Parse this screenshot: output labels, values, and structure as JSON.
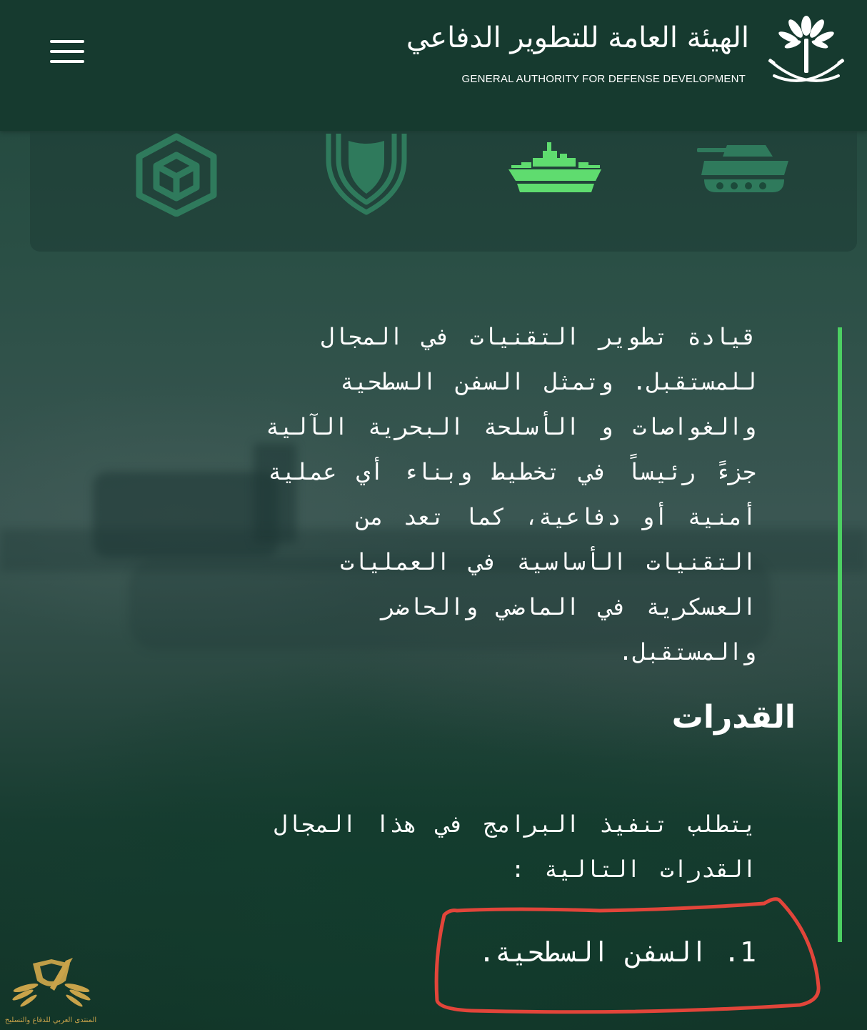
{
  "header": {
    "logo_arabic": "الهيئة العامة للتطوير الدفاعي",
    "logo_english": "GENERAL AUTHORITY FOR DEFENSE DEVELOPMENT",
    "menu_icon": "hamburger-menu-icon",
    "emblem_icon": "palm-and-swords-emblem"
  },
  "categories": [
    {
      "icon": "cube-icon",
      "active": false
    },
    {
      "icon": "shield-icon",
      "active": false
    },
    {
      "icon": "warship-icon",
      "active": true
    },
    {
      "icon": "tank-icon",
      "active": false
    }
  ],
  "content": {
    "paragraph_lines": [
      "قيادة تطوير التقنيات في المجال",
      "للمستقبل. وتمثل السفن السطحية",
      "والغواصات و الأسلحة البحرية الآلية",
      "جزءً رئيساً في تخطيط وبناء أي عملية",
      "أمنية أو دفاعية، كما تعد من",
      "التقنيات الأساسية في العمليات",
      "العسكرية في الماضي والحاضر",
      "والمستقبل."
    ],
    "heading": "القدرات",
    "paragraph2_lines": [
      "يتطلب تنفيذ البرامج في هذا المجال",
      "القدرات التالية :"
    ],
    "list_item": "1. السفن السطحية."
  },
  "watermark": {
    "text": "المنتدى العربي للدفاع والتسليح"
  },
  "colors": {
    "header_bg": "#163a2f",
    "accent_green": "#4ccf62",
    "icon_inactive": "#2f7a5c",
    "icon_active": "#5fdc6f",
    "annotation_red": "#e2453a",
    "watermark_gold": "#c9a34a"
  }
}
